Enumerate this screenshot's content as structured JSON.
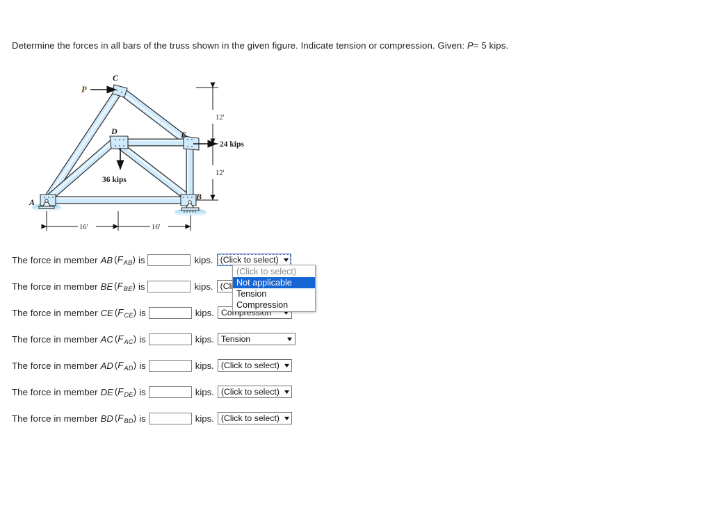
{
  "prompt": {
    "text_before": "Determine the forces in all bars of the truss shown in the given figure. Indicate tension or compression. Given: ",
    "given_symbol": "P",
    "given_value": "= 5 kips."
  },
  "figure": {
    "caption_nodes": [
      "A",
      "B",
      "C",
      "D",
      "E"
    ],
    "load_labels": {
      "p_label": "P",
      "horizontal_load": "24 kips",
      "vertical_load": "36 kips"
    },
    "dimensions": {
      "bottom_left": "16′",
      "bottom_right": "16′",
      "right_upper": "12′",
      "right_lower": "12′"
    },
    "colors": {
      "member_fill": "#b9dff4",
      "member_edge": "#2b2b2b",
      "ground": "#bfe3f5",
      "label_color": "#1a1a1a",
      "load_label_color": "#6b4a16"
    }
  },
  "questions": {
    "lead": "The force in member",
    "is_word": "is",
    "units": "kips.",
    "input_placeholder": "",
    "rows": [
      {
        "member": "AB",
        "symbol": "F",
        "subscript": "AB",
        "value": "",
        "selected": "(Click to select)"
      },
      {
        "member": "BE",
        "symbol": "F",
        "subscript": "BE",
        "value": "",
        "selected": "(Click to select)"
      },
      {
        "member": "CE",
        "symbol": "F",
        "subscript": "CE",
        "value": "",
        "selected": "Compression"
      },
      {
        "member": "AC",
        "symbol": "F",
        "subscript": "AC",
        "value": "",
        "selected": "Tension"
      },
      {
        "member": "AD",
        "symbol": "F",
        "subscript": "AD",
        "value": "",
        "selected": "(Click to select)"
      },
      {
        "member": "DE",
        "symbol": "F",
        "subscript": "DE",
        "value": "",
        "selected": "(Click to select)"
      },
      {
        "member": "BD",
        "symbol": "F",
        "subscript": "BD",
        "value": "",
        "selected": "(Click to select)"
      }
    ]
  },
  "dropdown": {
    "open_for_row": "AB",
    "options": [
      {
        "label": "(Click to select)",
        "state": "placeholder"
      },
      {
        "label": "Not applicable",
        "state": "selected"
      },
      {
        "label": "Tension",
        "state": "normal"
      },
      {
        "label": "Compression",
        "state": "normal"
      }
    ],
    "highlight_color": "#1464d6"
  }
}
